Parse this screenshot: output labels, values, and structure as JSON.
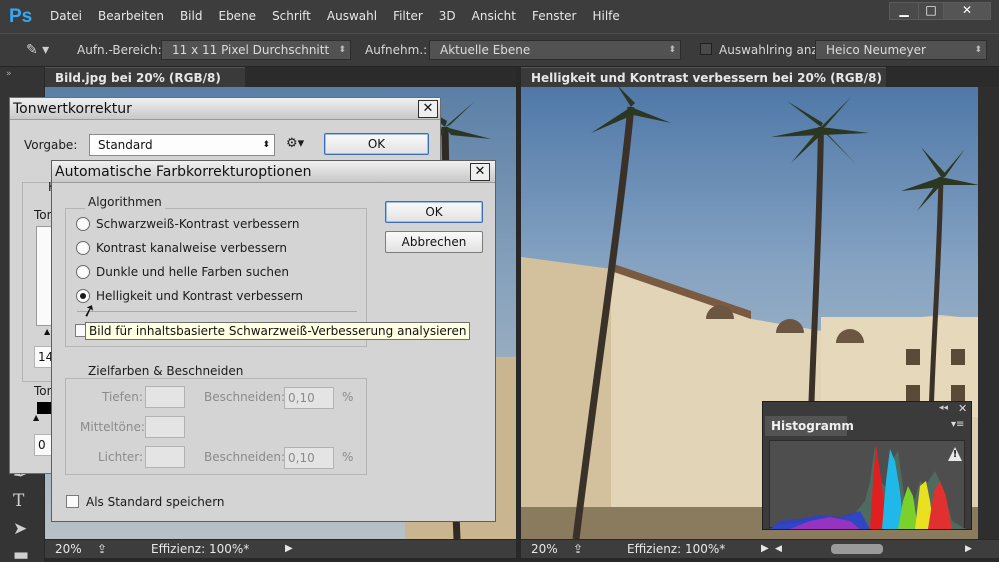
{
  "app": {
    "logo": "Ps"
  },
  "menu": [
    "Datei",
    "Bearbeiten",
    "Bild",
    "Ebene",
    "Schrift",
    "Auswahl",
    "Filter",
    "3D",
    "Ansicht",
    "Fenster",
    "Hilfe"
  ],
  "window_controls": {
    "minimize": "▁",
    "maximize": "□",
    "close": "✕"
  },
  "options_bar": {
    "area_label": "Aufn.-Bereich:",
    "area_value": "11 x 11 Pixel Durchschnitt",
    "sample_label": "Aufnehm.:",
    "sample_value": "Aktuelle Ebene",
    "ring_label": "Auswahlring anz",
    "workspace_value": "Heico Neumeyer"
  },
  "doc_left": {
    "tab_title": "Bild.jpg bei 20% (RGB/8) *",
    "zoom": "20%",
    "efficiency": "Effizienz: 100%*"
  },
  "doc_right": {
    "tab_title": "Helligkeit und Kontrast verbessern bei 20% (RGB/8) *",
    "zoom": "20%",
    "efficiency": "Effizienz: 100%*"
  },
  "levels_dialog": {
    "title": "Tonwertkorrektur",
    "preset_label": "Vorgabe:",
    "preset_value": "Standard",
    "ok": "OK",
    "partial_labels": [
      "K",
      "Ton",
      "14",
      "Ton",
      "0"
    ]
  },
  "auto_color_dialog": {
    "title": "Automatische Farbkorrekturoptionen",
    "algorithms_label": "Algorithmen",
    "algorithms": [
      {
        "label": "Schwarzweiß-Kontrast verbessern",
        "checked": false
      },
      {
        "label": "Kontrast kanalweise verbessern",
        "checked": false
      },
      {
        "label": "Dunkle und helle Farben suchen",
        "checked": false
      },
      {
        "label": "Helligkeit und Kontrast verbessern",
        "checked": true
      }
    ],
    "tooltip": "Bild für inhaltsbasierte Schwarzweiß-Verbesserung analysieren",
    "targets_label": "Zielfarben & Beschneiden",
    "shadows_label": "Tiefen:",
    "midtones_label": "Mitteltöne:",
    "highlights_label": "Lichter:",
    "clip_label": "Beschneiden:",
    "shadow_clip": "0,10",
    "highlight_clip": "0,10",
    "percent": "%",
    "save_default": "Als Standard speichern",
    "ok": "OK",
    "cancel": "Abbrechen"
  },
  "histogram": {
    "title": "Histogramm",
    "warning": "!"
  },
  "colors": {
    "accent": "#36a9f5",
    "panel": "#3b3b3b",
    "dialog": "#d4d4d4",
    "tooltip": "#ffffe1"
  }
}
